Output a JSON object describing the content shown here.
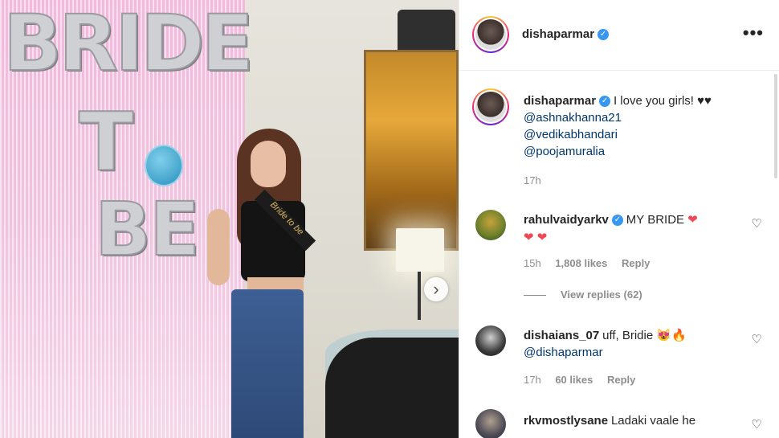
{
  "post": {
    "author": "dishaparmar",
    "more_icon": "•••",
    "caption": {
      "username": "dishaparmar",
      "text": "I love you girls! ♥♥",
      "mentions": [
        "@ashnakhanna21",
        "@vedikabhandari",
        "@poojamuralia"
      ],
      "time": "17h"
    },
    "photo": {
      "balloon_word_1": "BRIDE",
      "balloon_word_2": "T",
      "balloon_word_3": "BE",
      "sash_text": "Bride to be"
    }
  },
  "comments": [
    {
      "username": "rahulvaidyarkv",
      "text_before": "MY BRIDE ",
      "text_after": "",
      "hearts_line1": "❤",
      "hearts_line2": "❤ ❤",
      "time": "15h",
      "likes": "1,808 likes",
      "reply": "Reply",
      "view_replies": "View replies (62)"
    },
    {
      "username": "dishaians_07",
      "text": "uff, Bridie 😻🔥",
      "mention": "@dishaparmar",
      "time": "17h",
      "likes": "60 likes",
      "reply": "Reply"
    },
    {
      "username": "rkvmostlysane",
      "text": "Ladaki vaale he"
    }
  ],
  "colors": {
    "verified_blue": "#3897f0",
    "mention_blue": "#00376b",
    "meta_gray": "#8e8e8e",
    "heart_red": "#ed4956"
  },
  "icons": {
    "verified": "verified-badge-icon",
    "like": "heart-outline-icon",
    "next": "chevron-right-icon"
  }
}
